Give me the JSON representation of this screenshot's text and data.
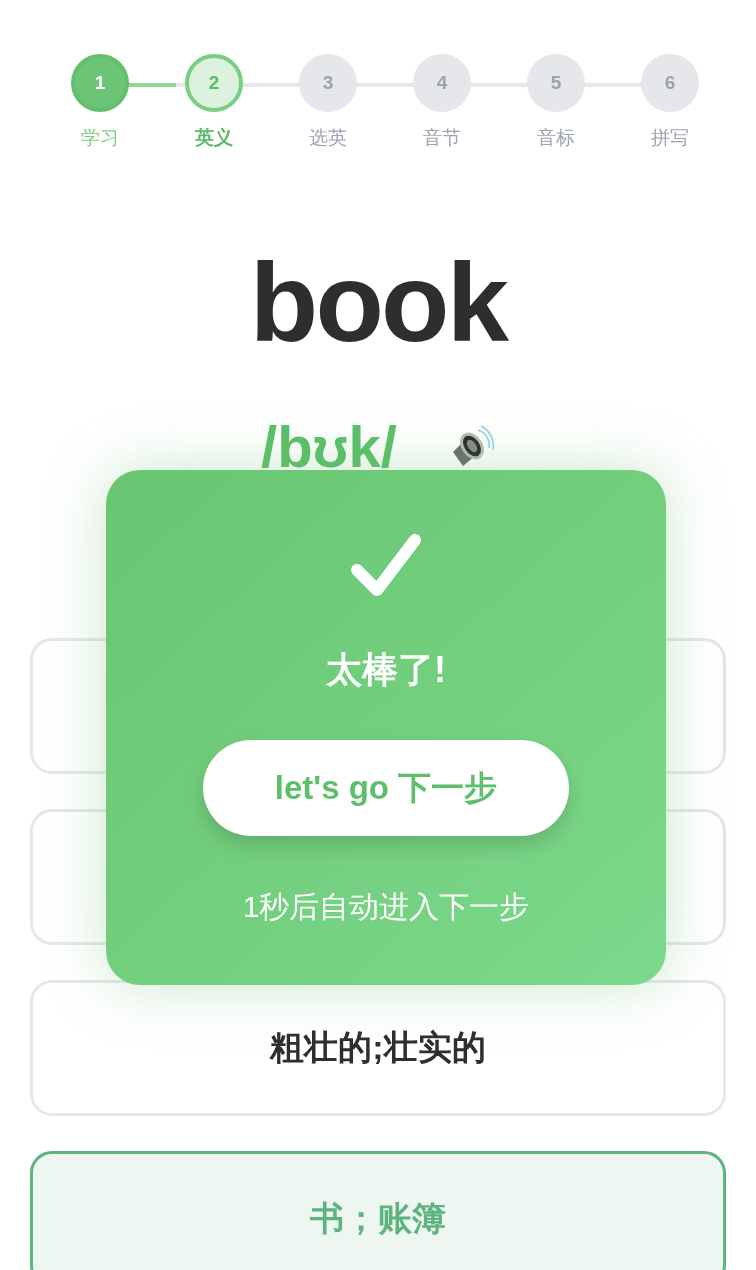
{
  "steps": [
    {
      "number": "1",
      "label": "学习",
      "kind": "done"
    },
    {
      "number": "2",
      "label": "英义",
      "kind": "current"
    },
    {
      "number": "3",
      "label": "选英",
      "kind": "todo"
    },
    {
      "number": "4",
      "label": "音节",
      "kind": "todo"
    },
    {
      "number": "5",
      "label": "音标",
      "kind": "todo"
    },
    {
      "number": "6",
      "label": "拼写",
      "kind": "todo"
    }
  ],
  "word": "book",
  "phonetic": "/bʊk/",
  "options": [
    {
      "selected": false
    },
    {
      "selected": false
    },
    {
      "text": "粗壮的;壮实的",
      "selected": false
    },
    {
      "text": "书；账簿",
      "selected": true
    }
  ],
  "feedback": {
    "title": "太棒了!",
    "button": "let's go 下一步",
    "note": "1秒后自动进入下一步"
  }
}
